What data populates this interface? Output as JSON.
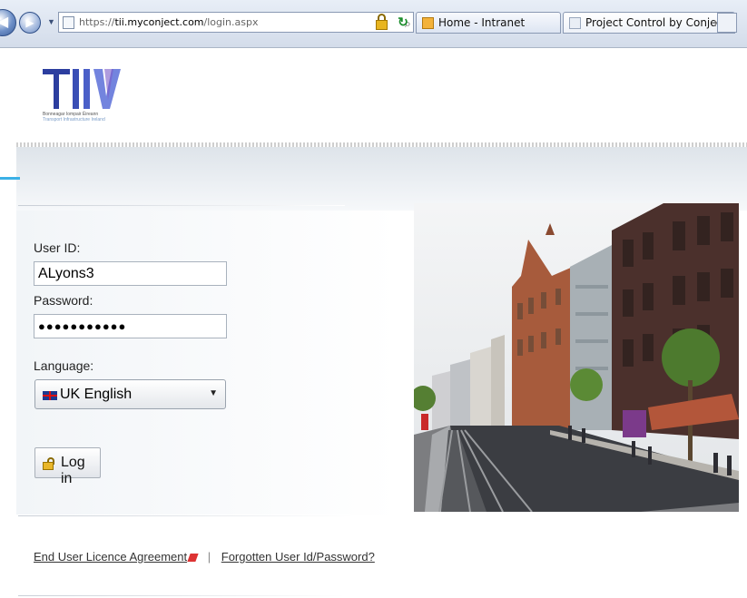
{
  "browser": {
    "url_prefix": "https://",
    "url_host": "tii.myconject.com",
    "url_path": "/login.aspx",
    "tabs": [
      {
        "label": "Home - Intranet"
      },
      {
        "label": "Project Control by Conject"
      }
    ],
    "tab_close": "x"
  },
  "logo": {
    "text": "TII",
    "tagline_irish": "Bonneagar Iompair Éireann",
    "tagline_english": "Transport Infrastructure Ireland"
  },
  "login": {
    "user_id_label": "User ID:",
    "user_id_value": "ALyons3",
    "password_label": "Password:",
    "password_value": "●●●●●●●●●●●",
    "language_label": "Language:",
    "language_value": "UK English",
    "login_button": "Log in"
  },
  "footer": {
    "eula_link": "End User Licence Agreement",
    "separator": "|",
    "forgot_link": "Forgotten User Id/Password?"
  },
  "colors": {
    "accent": "#3bb0e6",
    "logo_blue": "#2c3e9f",
    "logo_purple": "#5a3a9a"
  },
  "icons": [
    "back-icon",
    "forward-icon",
    "page-icon",
    "search-icon",
    "lock-icon",
    "refresh-icon",
    "uk-flag-icon",
    "padlock-icon",
    "pdf-icon"
  ]
}
